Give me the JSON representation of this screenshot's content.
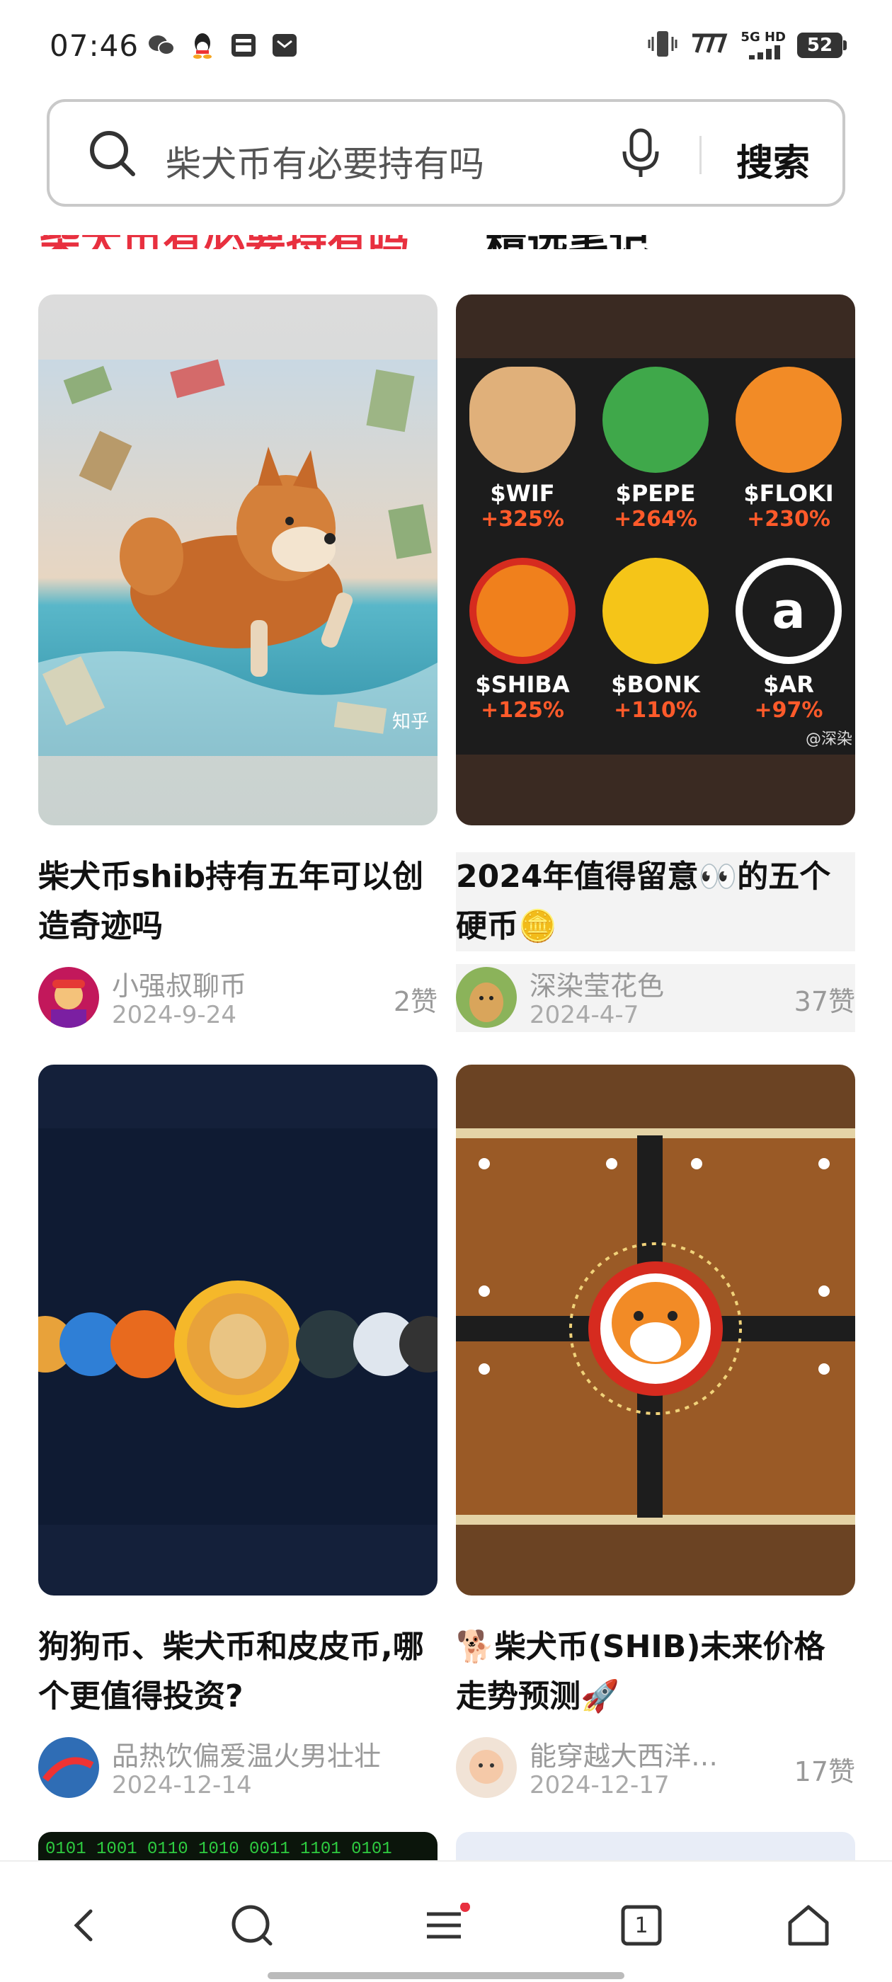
{
  "status_bar": {
    "time": "07:46",
    "network_label": "5G HD",
    "battery": "52",
    "icons": [
      "wechat-icon",
      "qq-icon",
      "inbox-icon",
      "message-icon",
      "vibrate-icon",
      "network-speed-icon",
      "signal-icon",
      "battery-icon"
    ]
  },
  "search": {
    "query": "柴犬币有必要持有吗",
    "button_label": "搜索",
    "icons": [
      "search-icon",
      "microphone-icon"
    ]
  },
  "tabs": {
    "first": "柴犬币有必要持有吗",
    "second": "精选笔记"
  },
  "cards": [
    {
      "title": "柴犬币shib持有五年可以创造奇迹吗",
      "author": "小强叔聊币",
      "date": "2024-9-24",
      "likes": "2赞",
      "image_watermark": "知乎"
    },
    {
      "title": "2024年值得留意👀的五个硬币🪙",
      "author": "深染莹花色",
      "date": "2024-4-7",
      "likes": "37赞",
      "coins": [
        {
          "name": "$WIF",
          "pct": "+325%"
        },
        {
          "name": "$PEPE",
          "pct": "+264%"
        },
        {
          "name": "$FLOKI",
          "pct": "+230%"
        },
        {
          "name": "$SHIBA",
          "pct": "+125%"
        },
        {
          "name": "$BONK",
          "pct": "+110%"
        },
        {
          "name": "$AR",
          "pct": "+97%"
        }
      ],
      "image_watermark": "@深染"
    },
    {
      "title": "狗狗币、柴犬币和皮皮币,哪个更值得投资?",
      "author": "品热饮偏爱温火男壮壮",
      "date": "2024-12-14",
      "likes": ""
    },
    {
      "title": "🐕柴犬币(SHIB)未来价格走势预测🚀",
      "author": "能穿越大西洋…",
      "date": "2024-12-17",
      "likes": "17赞"
    }
  ],
  "bottom_nav": {
    "icons": [
      "back-icon",
      "search-icon",
      "menu-icon",
      "tabs-icon",
      "home-icon"
    ],
    "tab_count": "1"
  },
  "colors": {
    "accent_red": "#e8303f",
    "text_primary": "#111111",
    "text_secondary": "#999999"
  }
}
